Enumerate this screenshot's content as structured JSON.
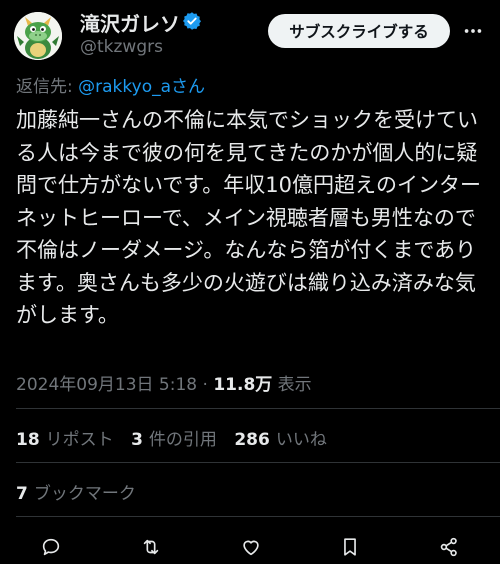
{
  "author": {
    "display_name": "滝沢ガレソ",
    "handle": "@tkzwgrs",
    "verified": true,
    "avatar_icon": "dragon-avatar-icon"
  },
  "header": {
    "subscribe_label": "サブスクライブする",
    "more_icon": "more-options-icon"
  },
  "reply": {
    "prefix": "返信先: ",
    "mention": "@rakkyo_aさん"
  },
  "tweet": {
    "text": "加藤純一さんの不倫に本気でショックを受けている人は今まで彼の何を見てきたのかが個人的に疑問で仕方がないです。年収10億円超えのインターネットヒーローで、メイン視聴者層も男性なので不倫はノーダメージ。なんなら箔が付くまであります。奥さんも多少の火遊びは織り込み済みな気がします。"
  },
  "meta": {
    "timestamp": "2024年09月13日 5:18",
    "separator": " · ",
    "views_count": "11.8万",
    "views_label": " 表示"
  },
  "stats": {
    "reposts_count": "18",
    "reposts_label": "リポスト",
    "quotes_count": "3",
    "quotes_label": "件の引用",
    "likes_count": "286",
    "likes_label": "いいね",
    "bookmarks_count": "7",
    "bookmarks_label": "ブックマーク"
  },
  "actions": [
    {
      "icon": "reply-icon"
    },
    {
      "icon": "repost-icon"
    },
    {
      "icon": "like-icon"
    },
    {
      "icon": "bookmark-icon"
    },
    {
      "icon": "share-icon"
    }
  ],
  "colors": {
    "background": "#000000",
    "text": "#e7e9ea",
    "muted": "#71767b",
    "accent": "#1d9bf0",
    "divider": "#2f3336"
  }
}
